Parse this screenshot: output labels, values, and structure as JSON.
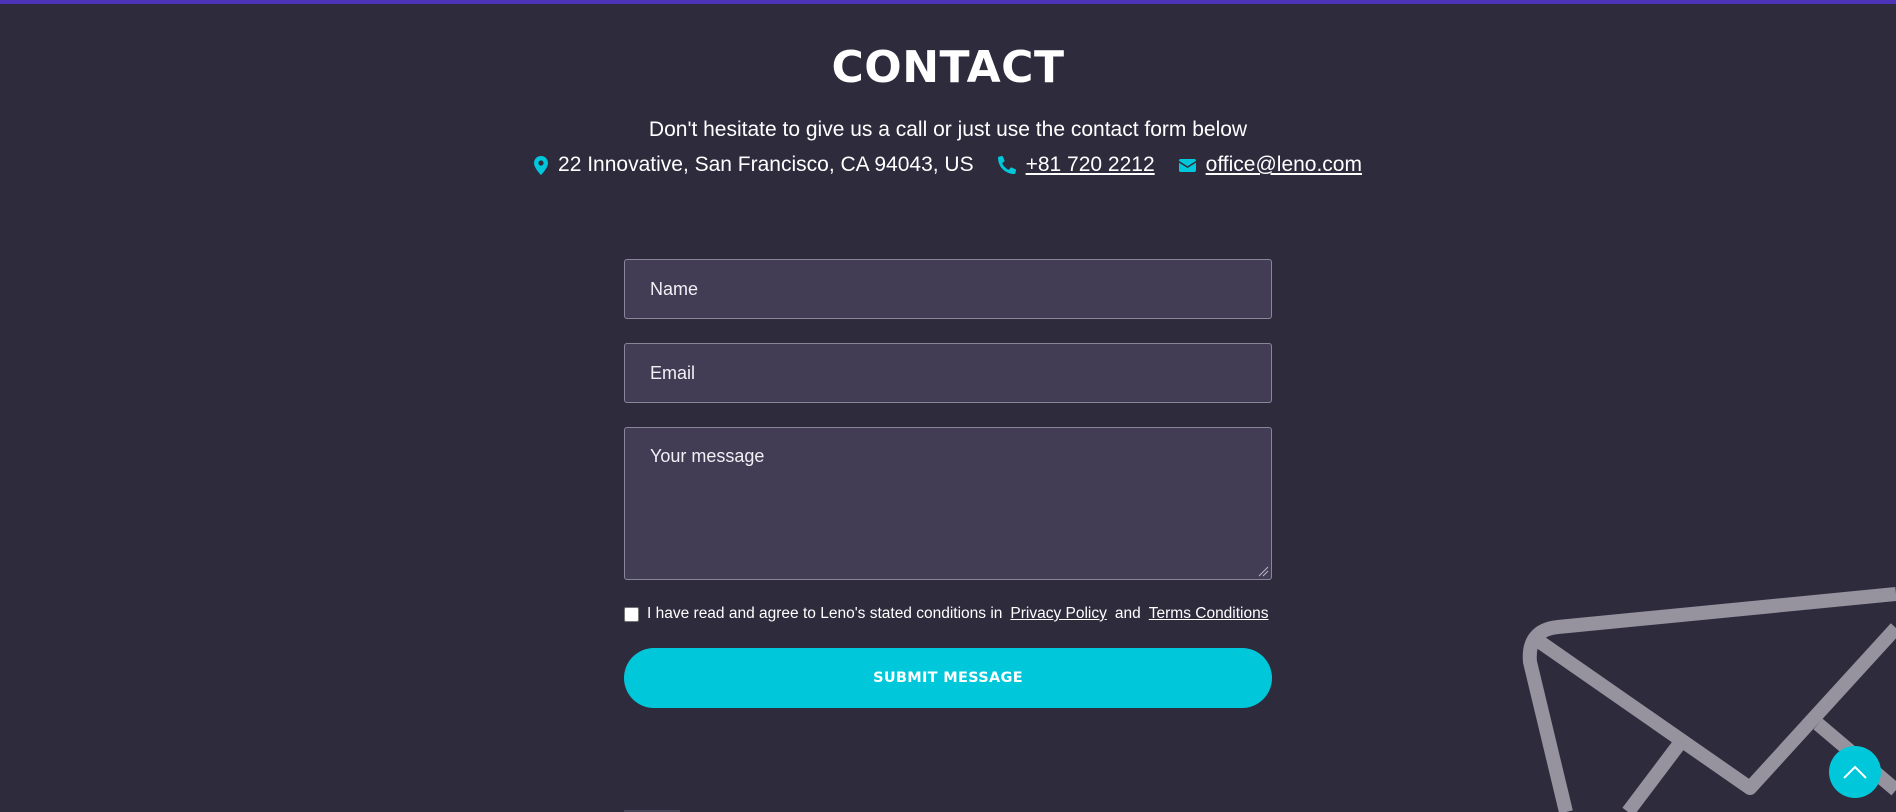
{
  "section": {
    "title": "CONTACT",
    "subtitle": "Don't hesitate to give us a call or just use the contact form below"
  },
  "contact": {
    "address": "22 Innovative, San Francisco, CA 94043, US",
    "phone": "+81 720 2212",
    "email": "office@leno.com",
    "address_icon": "map-marker-icon",
    "phone_icon": "phone-icon",
    "email_icon": "envelope-icon"
  },
  "form": {
    "name_placeholder": "Name",
    "email_placeholder": "Email",
    "message_placeholder": "Your message",
    "consent": {
      "text_before": "I have read and agree to Leno's stated conditions in",
      "privacy_link": "Privacy Policy",
      "and": "and",
      "terms_link": "Terms Conditions",
      "checked": false
    },
    "submit_label": "SUBMIT MESSAGE"
  },
  "colors": {
    "background": "#2e2b3d",
    "accent": "#00c8da",
    "top_bar": "#4b32b8",
    "field_background": "#423d55"
  },
  "decor": {
    "background_icon": "envelope-outline-icon",
    "scroll_top_icon": "chevron-up-icon"
  }
}
